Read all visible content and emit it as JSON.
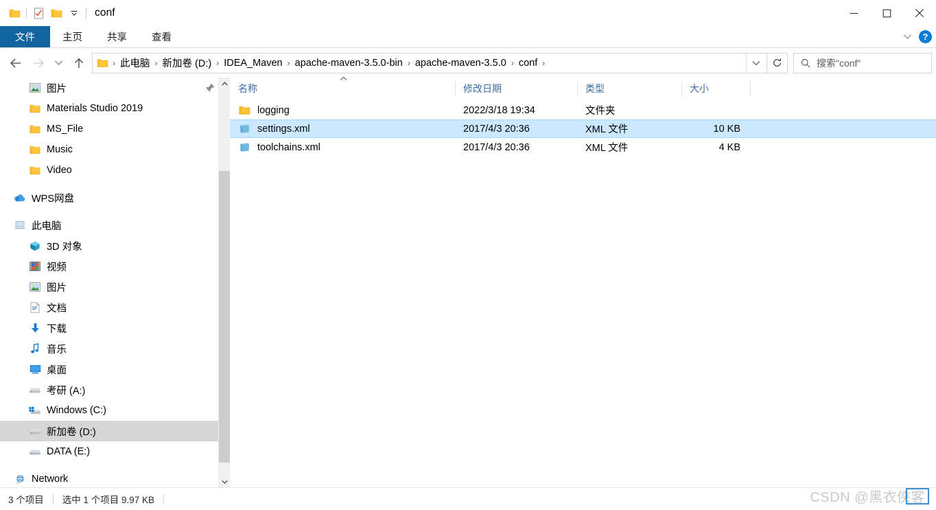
{
  "window": {
    "title": "conf",
    "quick_access": [
      "folder-icon",
      "properties-icon",
      "new-folder-icon",
      "customize-dropdown-icon"
    ],
    "controls": {
      "minimize": "minimize-icon",
      "maximize": "maximize-icon",
      "close": "close-icon"
    }
  },
  "ribbon": {
    "tabs": [
      {
        "label": "文件",
        "active": true
      },
      {
        "label": "主页",
        "active": false
      },
      {
        "label": "共享",
        "active": false
      },
      {
        "label": "查看",
        "active": false
      }
    ],
    "help_label": "?"
  },
  "address": {
    "back": "back-arrow-icon",
    "forward": "forward-arrow-icon",
    "recent": "recent-locations-icon",
    "up": "up-arrow-icon",
    "crumbs": [
      "此电脑",
      "新加卷 (D:)",
      "IDEA_Maven",
      "apache-maven-3.5.0-bin",
      "apache-maven-3.5.0",
      "conf"
    ],
    "separator": "›",
    "dropdown": "chevron-down-icon",
    "refresh": "refresh-icon",
    "search_placeholder": "搜索\"conf\""
  },
  "sidebar": {
    "groups": [
      {
        "items": [
          {
            "label": "图片",
            "icon": "pictures-icon",
            "level": 1,
            "selected": false
          },
          {
            "label": "Materials Studio 2019",
            "icon": "folder-icon",
            "level": 1,
            "selected": false
          },
          {
            "label": "MS_File",
            "icon": "folder-icon",
            "level": 1,
            "selected": false
          },
          {
            "label": "Music",
            "icon": "folder-icon",
            "level": 1,
            "selected": false
          },
          {
            "label": "Video",
            "icon": "folder-icon",
            "level": 1,
            "selected": false
          }
        ]
      },
      {
        "items": [
          {
            "label": "WPS网盘",
            "icon": "cloud-icon",
            "level": 0,
            "selected": false
          }
        ]
      },
      {
        "items": [
          {
            "label": "此电脑",
            "icon": "this-pc-icon",
            "level": 0,
            "selected": false
          },
          {
            "label": "3D 对象",
            "icon": "3d-objects-icon",
            "level": 1,
            "selected": false
          },
          {
            "label": "视频",
            "icon": "videos-icon",
            "level": 1,
            "selected": false
          },
          {
            "label": "图片",
            "icon": "pictures-icon",
            "level": 1,
            "selected": false
          },
          {
            "label": "文档",
            "icon": "documents-icon",
            "level": 1,
            "selected": false
          },
          {
            "label": "下载",
            "icon": "downloads-icon",
            "level": 1,
            "selected": false
          },
          {
            "label": "音乐",
            "icon": "music-icon",
            "level": 1,
            "selected": false
          },
          {
            "label": "桌面",
            "icon": "desktop-icon",
            "level": 1,
            "selected": false
          },
          {
            "label": "考研 (A:)",
            "icon": "drive-icon",
            "level": 1,
            "selected": false
          },
          {
            "label": "Windows (C:)",
            "icon": "windows-drive-icon",
            "level": 1,
            "selected": false
          },
          {
            "label": "新加卷 (D:)",
            "icon": "drive-icon",
            "level": 1,
            "selected": true
          },
          {
            "label": "DATA (E:)",
            "icon": "drive-icon",
            "level": 1,
            "selected": false
          }
        ]
      },
      {
        "items": [
          {
            "label": "Network",
            "icon": "network-icon",
            "level": 0,
            "selected": false
          }
        ]
      }
    ],
    "pin": "pin-icon"
  },
  "filelist": {
    "columns": [
      {
        "key": "name",
        "label": "名称",
        "sorted": "asc"
      },
      {
        "key": "date",
        "label": "修改日期"
      },
      {
        "key": "type",
        "label": "类型"
      },
      {
        "key": "size",
        "label": "大小"
      }
    ],
    "sort_indicator": "▲",
    "rows": [
      {
        "name": "logging",
        "date": "2022/3/18 19:34",
        "type": "文件夹",
        "size": "",
        "icon": "folder-icon",
        "selected": false
      },
      {
        "name": "settings.xml",
        "date": "2017/4/3 20:36",
        "type": "XML 文件",
        "size": "10 KB",
        "icon": "xml-file-icon",
        "selected": true
      },
      {
        "name": "toolchains.xml",
        "date": "2017/4/3 20:36",
        "type": "XML 文件",
        "size": "4 KB",
        "icon": "xml-file-icon",
        "selected": false
      }
    ]
  },
  "status": {
    "item_count": "3 个项目",
    "selection": "选中 1 个项目  9.97 KB"
  },
  "watermark": {
    "text": "CSDN @黑衣侠客"
  },
  "colors": {
    "accent": "#11659E",
    "selection": "#cce8ff",
    "selection_border": "#a8d8ff",
    "sidebar_selection": "#d6d6d6",
    "column_header_text": "#3a6ea5",
    "help_blue": "#0C7CD5"
  }
}
